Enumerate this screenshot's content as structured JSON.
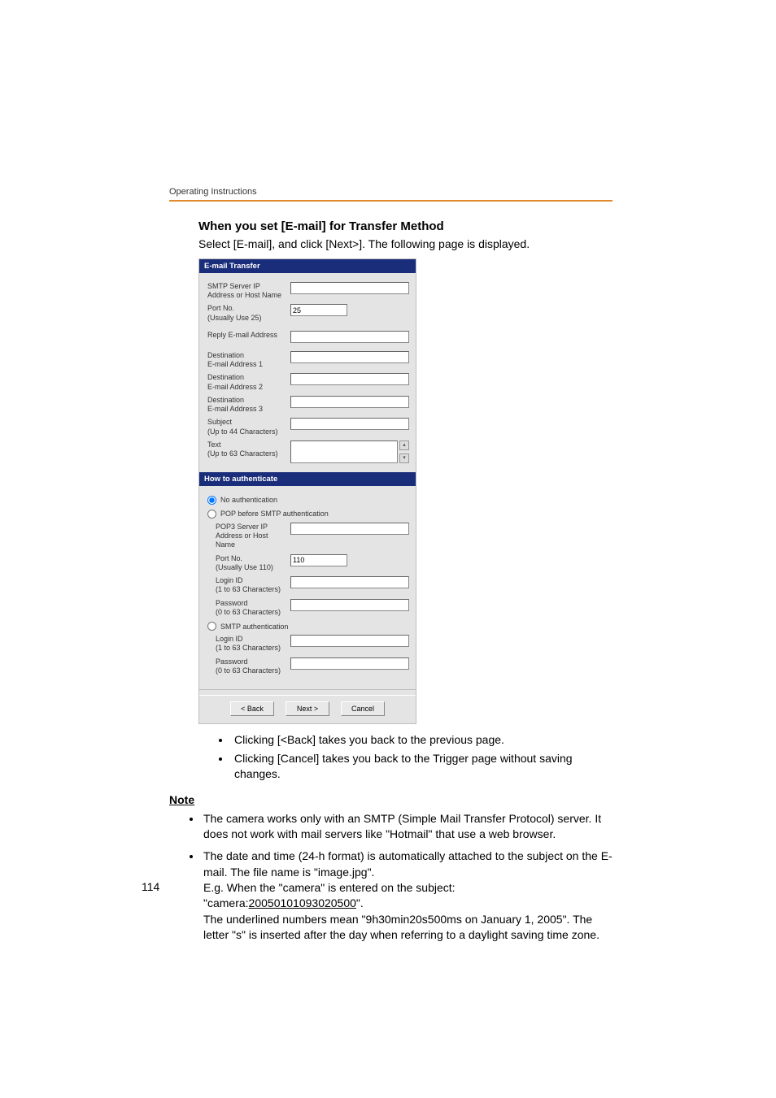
{
  "header": {
    "running": "Operating Instructions"
  },
  "section": {
    "heading": "When you set [E-mail] for Transfer Method",
    "intro": "Select [E-mail], and click [Next>]. The following page is displayed."
  },
  "panel": {
    "section1_title": "E-mail Transfer",
    "smtp_label": "SMTP Server IP Address or Host Name",
    "smtp_value": "",
    "port_label": "Port No.\n(Usually Use 25)",
    "port_value": "25",
    "reply_label": "Reply E-mail Address",
    "reply_value": "",
    "dest1_label": "Destination\nE-mail Address 1",
    "dest1_value": "",
    "dest2_label": "Destination\nE-mail Address 2",
    "dest2_value": "",
    "dest3_label": "Destination\nE-mail Address 3",
    "dest3_value": "",
    "subject_label": "Subject\n(Up to 44 Characters)",
    "subject_value": "",
    "text_label": "Text\n(Up to 63 Characters)",
    "text_value": "",
    "section2_title": "How to authenticate",
    "auth_none": "No authentication",
    "auth_pop": "POP before SMTP authentication",
    "pop3_label": "POP3 Server IP Address or Host Name",
    "pop3_value": "",
    "pop3_port_label": "Port No.\n(Usually Use 110)",
    "pop3_port_value": "110",
    "pop_login_label": "Login ID\n(1 to 63 Characters)",
    "pop_login_value": "",
    "pop_pw_label": "Password\n(0 to 63 Characters)",
    "pop_pw_value": "",
    "auth_smtp": "SMTP authentication",
    "smtp_login_label": "Login ID\n(1 to 63 Characters)",
    "smtp_login_value": "",
    "smtp_pw_label": "Password\n(0 to 63 Characters)",
    "smtp_pw_value": "",
    "btn_back": "< Back",
    "btn_next": "Next >",
    "btn_cancel": "Cancel"
  },
  "bullets": {
    "b1": "Clicking [<Back] takes you back to the previous page.",
    "b2": "Clicking [Cancel] takes you back to the Trigger page without saving changes."
  },
  "note": {
    "heading": "Note",
    "n1": "The camera works only with an SMTP (Simple Mail Transfer Protocol) server. It does not work with mail servers like \"Hotmail\" that use a web browser.",
    "n2a": "The date and time (24-h format) is automatically attached to the subject on the E-mail. The file name is \"image.jpg\".",
    "n2b": "E.g. When the \"camera\" is entered on the subject:",
    "n2c_pre": "\"camera:",
    "n2c_mid": "20050101093020500",
    "n2c_post": "\".",
    "n2d": "The underlined numbers mean \"9h30min20s500ms on January 1, 2005\". The letter \"s\" is inserted after the day when referring to a daylight saving time zone."
  },
  "page_number": "114"
}
